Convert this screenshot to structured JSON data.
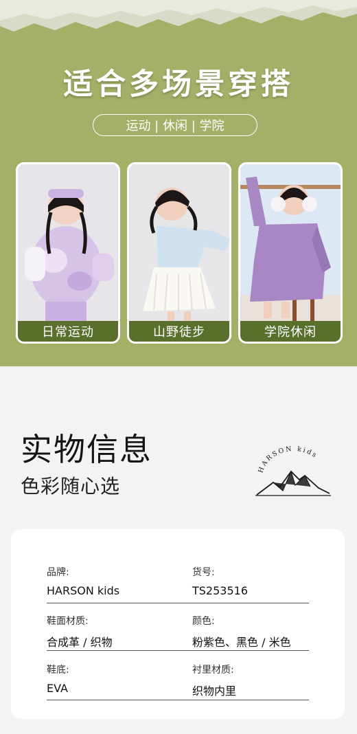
{
  "header": {
    "title": "适合多场景穿搭",
    "tags": "运动 | 休闲 | 学院"
  },
  "scenes": [
    {
      "label": "日常运动"
    },
    {
      "label": "山野徒步"
    },
    {
      "label": "学院休闲"
    }
  ],
  "info": {
    "title": "实物信息",
    "subtitle": "色彩随心选",
    "logo_text": "HARSON kids"
  },
  "specs": [
    {
      "label": "品牌:",
      "value": "HARSON kids"
    },
    {
      "label": "货号:",
      "value": "TS253516"
    },
    {
      "label": "鞋面材质:",
      "value": "合成革 / 织物"
    },
    {
      "label": "颜色:",
      "value": "粉紫色、黑色 / 米色"
    },
    {
      "label": "鞋底:",
      "value": "EVA"
    },
    {
      "label": "衬里材质:",
      "value": "织物内里"
    }
  ],
  "colors": {
    "green_bg": "#a4b067",
    "caption_bg": "#5a6f2c",
    "page_bg": "#f3f3f3"
  }
}
